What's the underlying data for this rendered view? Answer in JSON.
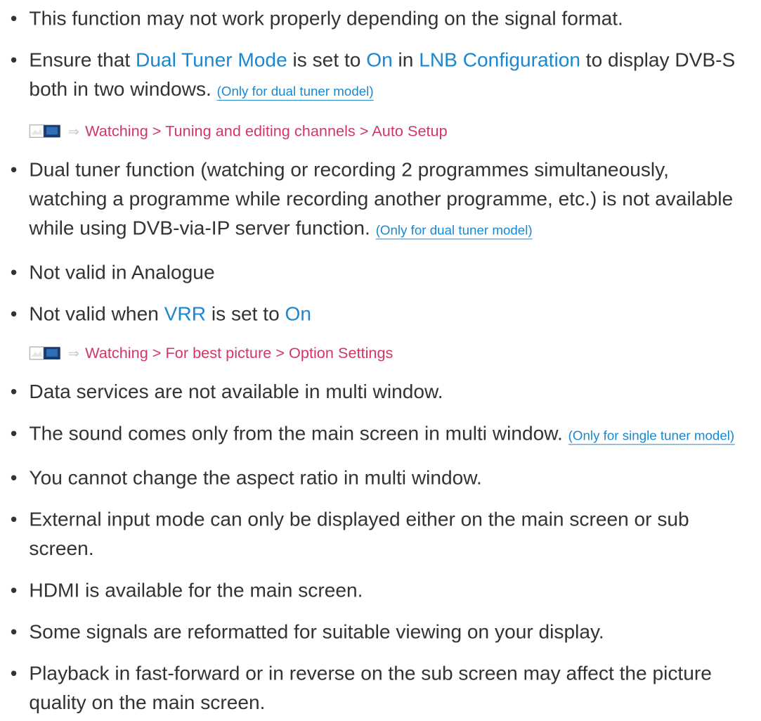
{
  "items": [
    {
      "pre": "This function may not work properly depending on the signal format."
    },
    {
      "pre": "Ensure that ",
      "k1": "Dual Tuner Mode",
      "m1": " is set to ",
      "k2": "On",
      "m2": " in ",
      "k3": "LNB Configuration",
      "m3": " to display DVB-S both in two windows. ",
      "note": "(Only for dual tuner model)"
    },
    {
      "pre": "Dual tuner function (watching or recording 2 programmes simultaneously, watching a programme while recording another programme, etc.) is not available while using DVB-via-IP server function. ",
      "note": "(Only for dual tuner model)"
    },
    {
      "pre": "Not valid in Analogue"
    },
    {
      "pre": "Not valid when ",
      "k1": "VRR",
      "m1": " is set to ",
      "k2": "On"
    },
    {
      "pre": "Data services are not available in multi window."
    },
    {
      "pre": "The sound comes only from the main screen in multi window. ",
      "note": "(Only for single tuner model)"
    },
    {
      "pre": "You cannot change the aspect ratio in multi window."
    },
    {
      "pre": "External input mode can only be displayed either on the main screen or sub screen."
    },
    {
      "pre": "HDMI is available for the main screen."
    },
    {
      "pre": "Some signals are reformatted for suitable viewing on your display."
    },
    {
      "pre": "Playback in fast-forward or in reverse on the sub screen may affect the picture quality on the main screen."
    }
  ],
  "refs": [
    {
      "text": "Watching > Tuning and editing channels > Auto Setup"
    },
    {
      "text": "Watching > For best picture > Option Settings"
    }
  ],
  "bullet": "•",
  "arrow": "⇒",
  "colors": {
    "text": "#333333",
    "keyword": "#1a88d0",
    "reference": "#d13764",
    "arrow": "#c8c8c8"
  },
  "icons": {
    "reference": "tv-manual-icon"
  }
}
